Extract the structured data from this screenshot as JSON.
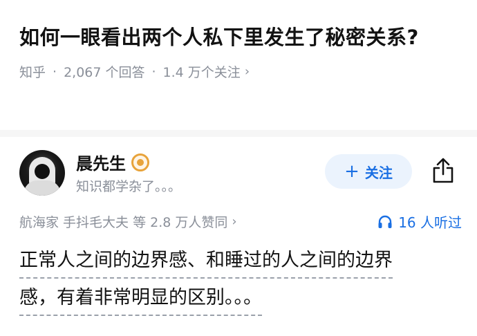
{
  "question": {
    "title": "如何一眼看出两个人私下里发生了秘密关系?",
    "source": "知乎",
    "answers_count": "2,067 个回答",
    "followers": "1.4 万个关注",
    "chevron": "›"
  },
  "author": {
    "name": "晨先生",
    "badge_icon": "badge-icon",
    "bio": "知识都学杂了。。。",
    "follow_label": "关注",
    "follow_icon": "+",
    "share_icon": "share-icon"
  },
  "stats": {
    "endorsers": "航海家 手抖毛大夫 等 2.8 万人赞同",
    "chevron": "›",
    "listen_icon": "headphones-icon",
    "listen_text": "16 人听过"
  },
  "answer": {
    "line1": "正常人之间的边界感、和睡过的人之间的边界",
    "line2": "感，有着非常明显的区别。。。"
  },
  "colors": {
    "accent": "#1a6fe3",
    "muted": "#8a8f99",
    "badge": "#e8a33a"
  }
}
